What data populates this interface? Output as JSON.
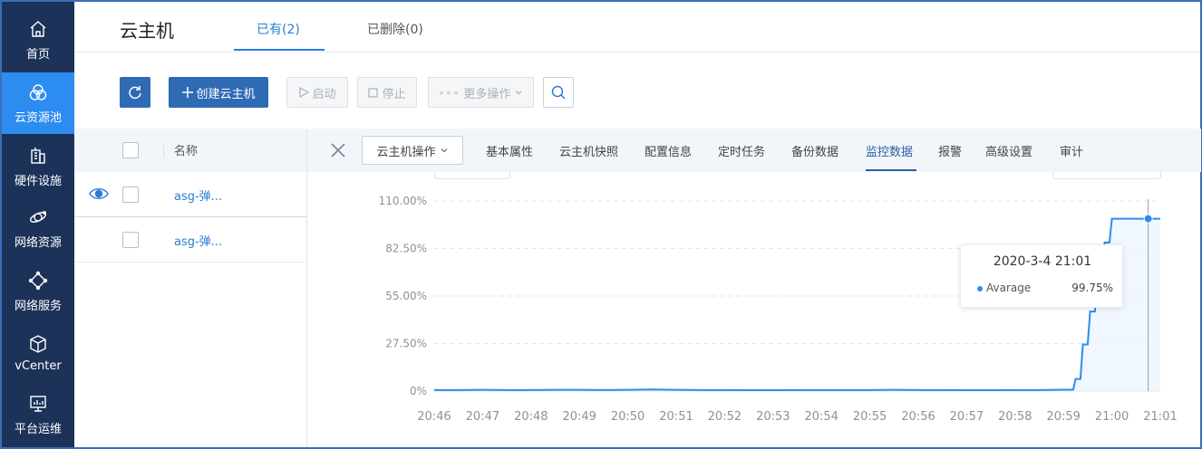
{
  "sidebar": {
    "items": [
      {
        "label": "首页",
        "icon": "home-icon"
      },
      {
        "label": "云资源池",
        "icon": "cloud-pool-icon",
        "active": true
      },
      {
        "label": "硬件设施",
        "icon": "building-icon"
      },
      {
        "label": "网络资源",
        "icon": "network-resource-icon"
      },
      {
        "label": "网络服务",
        "icon": "network-service-icon"
      },
      {
        "label": "vCenter",
        "icon": "cube-icon"
      },
      {
        "label": "平台运维",
        "icon": "monitor-icon"
      }
    ]
  },
  "header": {
    "title": "云主机",
    "tabs": [
      {
        "label": "已有(2)",
        "active": true
      },
      {
        "label": "已删除(0)"
      }
    ]
  },
  "toolbar": {
    "create_label": "创建云主机",
    "start_label": "启动",
    "stop_label": "停止",
    "more_label": "更多操作"
  },
  "list": {
    "column_name": "名称",
    "rows": [
      {
        "name": "asg-弹...",
        "selected": true
      },
      {
        "name": "asg-弹..."
      }
    ]
  },
  "detail": {
    "op_select_label": "云主机操作",
    "tabs": [
      "基本属性",
      "云主机快照",
      "配置信息",
      "定时任务",
      "备份数据",
      "监控数据",
      "报警",
      "高级设置",
      "审计"
    ],
    "active_tab": "监控数据"
  },
  "chart_data": {
    "type": "line",
    "title": "",
    "xlabel": "",
    "ylabel": "",
    "ylim": [
      0,
      110
    ],
    "y_ticks": [
      "110.00%",
      "82.50%",
      "55.00%",
      "27.50%",
      "0%"
    ],
    "x_ticks": [
      "20:46",
      "20:47",
      "20:48",
      "20:49",
      "20:50",
      "20:51",
      "20:52",
      "20:53",
      "20:54",
      "20:55",
      "20:56",
      "20:57",
      "20:58",
      "20:59",
      "21:00",
      "21:01"
    ],
    "grid": true,
    "series": [
      {
        "name": "Avarage",
        "color": "#2d8cf0",
        "points": [
          [
            0,
            0.6
          ],
          [
            0.5,
            0.6
          ],
          [
            1,
            0.7
          ],
          [
            1.5,
            0.6
          ],
          [
            2,
            0.6
          ],
          [
            2.5,
            0.7
          ],
          [
            3,
            0.7
          ],
          [
            3.5,
            0.6
          ],
          [
            4,
            0.7
          ],
          [
            4.5,
            0.9
          ],
          [
            5,
            0.7
          ],
          [
            5.5,
            0.6
          ],
          [
            6,
            0.6
          ],
          [
            6.5,
            0.5
          ],
          [
            7,
            0.5
          ],
          [
            7.5,
            0.6
          ],
          [
            8,
            0.6
          ],
          [
            8.5,
            0.6
          ],
          [
            9,
            0.6
          ],
          [
            9.5,
            0.7
          ],
          [
            10,
            0.6
          ],
          [
            10.5,
            0.6
          ],
          [
            11,
            0.5
          ],
          [
            11.5,
            0.5
          ],
          [
            12,
            0.6
          ],
          [
            12.5,
            0.6
          ],
          [
            13,
            0.8
          ],
          [
            13.2,
            0.8
          ],
          [
            13.25,
            7
          ],
          [
            13.35,
            7
          ],
          [
            13.4,
            27
          ],
          [
            13.5,
            27
          ],
          [
            13.55,
            46
          ],
          [
            13.65,
            46
          ],
          [
            13.7,
            65
          ],
          [
            13.8,
            65
          ],
          [
            13.85,
            86
          ],
          [
            13.95,
            86
          ],
          [
            14,
            99.75
          ],
          [
            15,
            99.75
          ]
        ]
      }
    ],
    "tooltip": {
      "time": "2020-3-4 21:01",
      "series": "Avarage",
      "value": "99.75%"
    }
  },
  "colors": {
    "sidebar_bg": "#1c3258",
    "accent": "#2d8cf0",
    "primary_button": "#2f6bb5"
  }
}
